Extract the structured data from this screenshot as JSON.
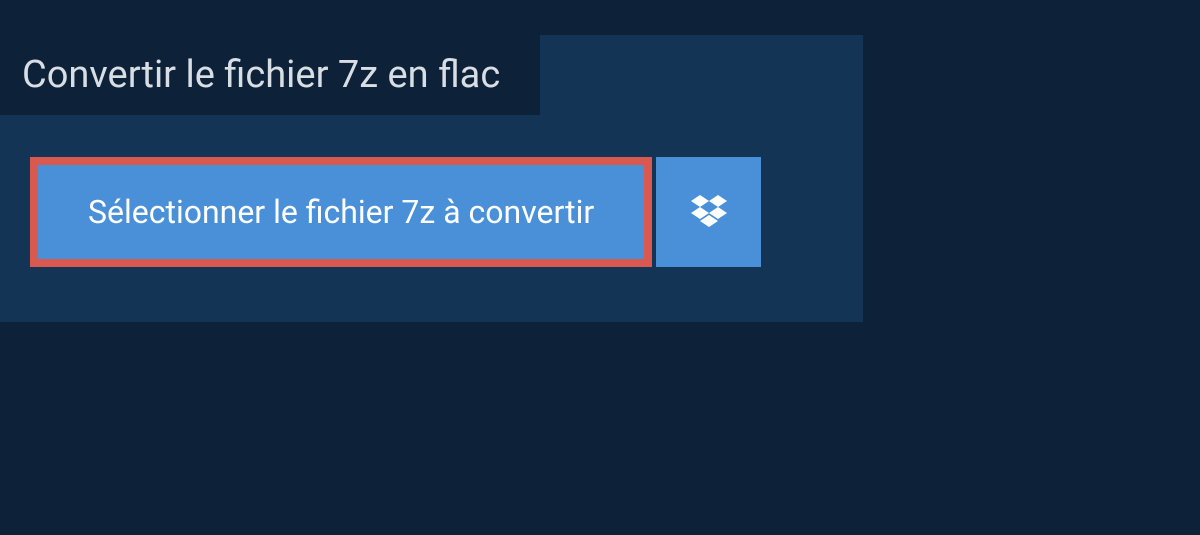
{
  "title": "Convertir le fichier 7z en flac",
  "select_button_label": "Sélectionner le fichier 7z à convertir"
}
